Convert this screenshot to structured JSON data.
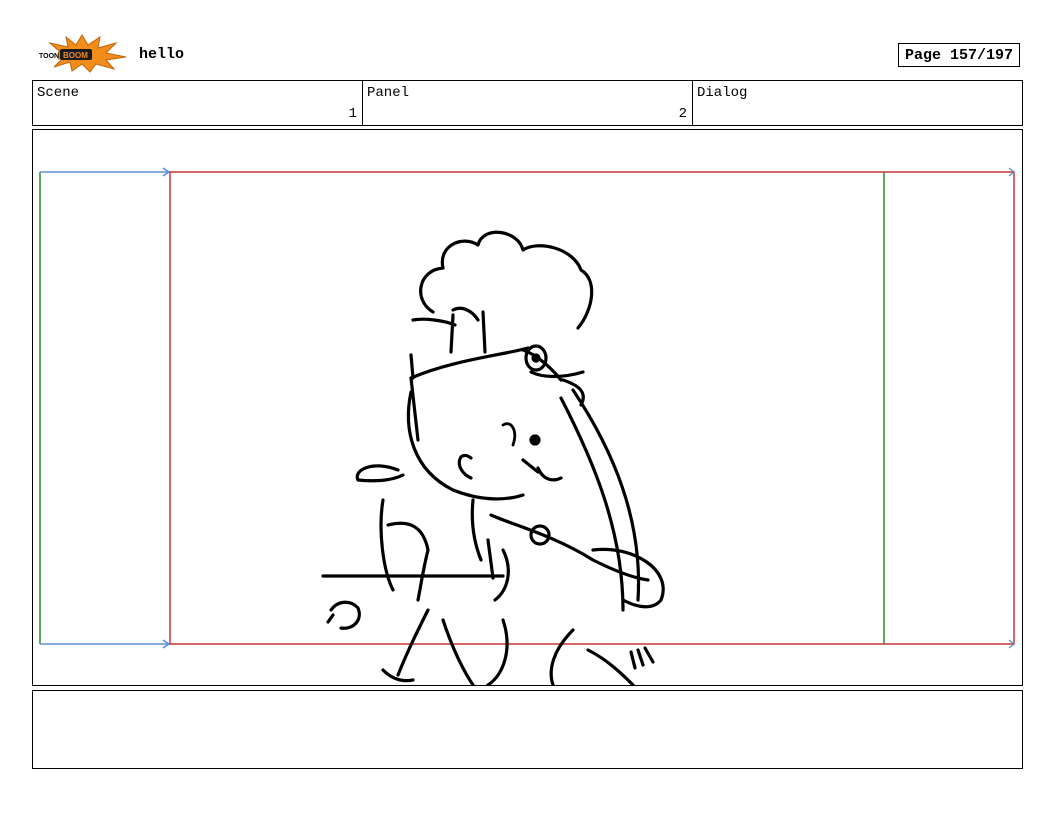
{
  "header": {
    "logo_text": "TOON BOOM",
    "title": "hello",
    "page_label": "Page 157/197"
  },
  "fields": {
    "scene_label": "Scene",
    "scene_value": "1",
    "panel_label": "Panel",
    "panel_value": "2",
    "dialog_label": "Dialog",
    "dialog_value": ""
  },
  "colors": {
    "safe_frame_green": "#2e8b2e",
    "camera_frame_red": "#cc3333",
    "arrow_blue": "#5b8fd6",
    "logo_orange": "#f28c1b"
  },
  "notes": {
    "text": ""
  }
}
